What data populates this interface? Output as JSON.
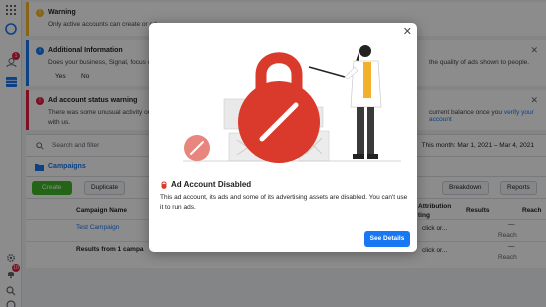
{
  "rail": {
    "notification_count": "1",
    "bottom_badge_count": "10"
  },
  "banners": {
    "warning": {
      "title": "Warning",
      "text": "Only active accounts can create or ed"
    },
    "info": {
      "title": "Additional Information",
      "text_left": "Does your business, Signal, focus on y",
      "text_right": "the quality of ads shown to people.",
      "yes": "Yes",
      "no": "No"
    },
    "error": {
      "title": "Ad account status warning",
      "text_left": "There was some unusual activity on y",
      "text_right_plain": "current balance once you ",
      "text_right_link": "verify your account",
      "text_line2": "with us."
    }
  },
  "toolbar": {
    "search_placeholder": "Search and filter",
    "date_range": "This month: Mar 1, 2021 – Mar 4, 2021"
  },
  "tabs": {
    "campaigns": "Campaigns"
  },
  "actions": {
    "create": "Create",
    "duplicate": "Duplicate",
    "breakdown": "Breakdown",
    "reports": "Reports"
  },
  "table": {
    "headers": {
      "campaign_name": "Campaign Name",
      "attribution": "Attribution",
      "attribution2": "ting",
      "results": "Results",
      "reach": "Reach"
    },
    "rows": [
      {
        "name": "Test Campaign",
        "attr": "click or...",
        "results": "—",
        "reach_sub": "Reach"
      }
    ],
    "summary": {
      "label": "Results from 1 campa",
      "attr": "click or...",
      "results": "—",
      "reach_sub": "Reach"
    }
  },
  "modal": {
    "title": "Ad Account Disabled",
    "body": "This ad account, its ads and some of its advertising assets are disabled. You can't use it to run ads.",
    "button": "See Details",
    "colors": {
      "lock": "#d93a2b",
      "lock_light": "#e8857c",
      "primary": "#1877f2"
    }
  }
}
